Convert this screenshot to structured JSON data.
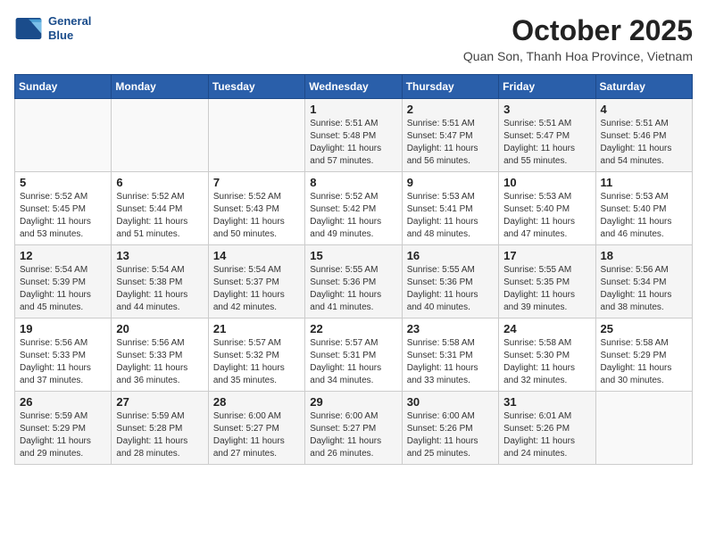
{
  "logo": {
    "line1": "General",
    "line2": "Blue"
  },
  "title": "October 2025",
  "subtitle": "Quan Son, Thanh Hoa Province, Vietnam",
  "days_of_week": [
    "Sunday",
    "Monday",
    "Tuesday",
    "Wednesday",
    "Thursday",
    "Friday",
    "Saturday"
  ],
  "weeks": [
    [
      {
        "day": "",
        "info": ""
      },
      {
        "day": "",
        "info": ""
      },
      {
        "day": "",
        "info": ""
      },
      {
        "day": "1",
        "info": "Sunrise: 5:51 AM\nSunset: 5:48 PM\nDaylight: 11 hours and 57 minutes."
      },
      {
        "day": "2",
        "info": "Sunrise: 5:51 AM\nSunset: 5:47 PM\nDaylight: 11 hours and 56 minutes."
      },
      {
        "day": "3",
        "info": "Sunrise: 5:51 AM\nSunset: 5:47 PM\nDaylight: 11 hours and 55 minutes."
      },
      {
        "day": "4",
        "info": "Sunrise: 5:51 AM\nSunset: 5:46 PM\nDaylight: 11 hours and 54 minutes."
      }
    ],
    [
      {
        "day": "5",
        "info": "Sunrise: 5:52 AM\nSunset: 5:45 PM\nDaylight: 11 hours and 53 minutes."
      },
      {
        "day": "6",
        "info": "Sunrise: 5:52 AM\nSunset: 5:44 PM\nDaylight: 11 hours and 51 minutes."
      },
      {
        "day": "7",
        "info": "Sunrise: 5:52 AM\nSunset: 5:43 PM\nDaylight: 11 hours and 50 minutes."
      },
      {
        "day": "8",
        "info": "Sunrise: 5:52 AM\nSunset: 5:42 PM\nDaylight: 11 hours and 49 minutes."
      },
      {
        "day": "9",
        "info": "Sunrise: 5:53 AM\nSunset: 5:41 PM\nDaylight: 11 hours and 48 minutes."
      },
      {
        "day": "10",
        "info": "Sunrise: 5:53 AM\nSunset: 5:40 PM\nDaylight: 11 hours and 47 minutes."
      },
      {
        "day": "11",
        "info": "Sunrise: 5:53 AM\nSunset: 5:40 PM\nDaylight: 11 hours and 46 minutes."
      }
    ],
    [
      {
        "day": "12",
        "info": "Sunrise: 5:54 AM\nSunset: 5:39 PM\nDaylight: 11 hours and 45 minutes."
      },
      {
        "day": "13",
        "info": "Sunrise: 5:54 AM\nSunset: 5:38 PM\nDaylight: 11 hours and 44 minutes."
      },
      {
        "day": "14",
        "info": "Sunrise: 5:54 AM\nSunset: 5:37 PM\nDaylight: 11 hours and 42 minutes."
      },
      {
        "day": "15",
        "info": "Sunrise: 5:55 AM\nSunset: 5:36 PM\nDaylight: 11 hours and 41 minutes."
      },
      {
        "day": "16",
        "info": "Sunrise: 5:55 AM\nSunset: 5:36 PM\nDaylight: 11 hours and 40 minutes."
      },
      {
        "day": "17",
        "info": "Sunrise: 5:55 AM\nSunset: 5:35 PM\nDaylight: 11 hours and 39 minutes."
      },
      {
        "day": "18",
        "info": "Sunrise: 5:56 AM\nSunset: 5:34 PM\nDaylight: 11 hours and 38 minutes."
      }
    ],
    [
      {
        "day": "19",
        "info": "Sunrise: 5:56 AM\nSunset: 5:33 PM\nDaylight: 11 hours and 37 minutes."
      },
      {
        "day": "20",
        "info": "Sunrise: 5:56 AM\nSunset: 5:33 PM\nDaylight: 11 hours and 36 minutes."
      },
      {
        "day": "21",
        "info": "Sunrise: 5:57 AM\nSunset: 5:32 PM\nDaylight: 11 hours and 35 minutes."
      },
      {
        "day": "22",
        "info": "Sunrise: 5:57 AM\nSunset: 5:31 PM\nDaylight: 11 hours and 34 minutes."
      },
      {
        "day": "23",
        "info": "Sunrise: 5:58 AM\nSunset: 5:31 PM\nDaylight: 11 hours and 33 minutes."
      },
      {
        "day": "24",
        "info": "Sunrise: 5:58 AM\nSunset: 5:30 PM\nDaylight: 11 hours and 32 minutes."
      },
      {
        "day": "25",
        "info": "Sunrise: 5:58 AM\nSunset: 5:29 PM\nDaylight: 11 hours and 30 minutes."
      }
    ],
    [
      {
        "day": "26",
        "info": "Sunrise: 5:59 AM\nSunset: 5:29 PM\nDaylight: 11 hours and 29 minutes."
      },
      {
        "day": "27",
        "info": "Sunrise: 5:59 AM\nSunset: 5:28 PM\nDaylight: 11 hours and 28 minutes."
      },
      {
        "day": "28",
        "info": "Sunrise: 6:00 AM\nSunset: 5:27 PM\nDaylight: 11 hours and 27 minutes."
      },
      {
        "day": "29",
        "info": "Sunrise: 6:00 AM\nSunset: 5:27 PM\nDaylight: 11 hours and 26 minutes."
      },
      {
        "day": "30",
        "info": "Sunrise: 6:00 AM\nSunset: 5:26 PM\nDaylight: 11 hours and 25 minutes."
      },
      {
        "day": "31",
        "info": "Sunrise: 6:01 AM\nSunset: 5:26 PM\nDaylight: 11 hours and 24 minutes."
      },
      {
        "day": "",
        "info": ""
      }
    ]
  ]
}
